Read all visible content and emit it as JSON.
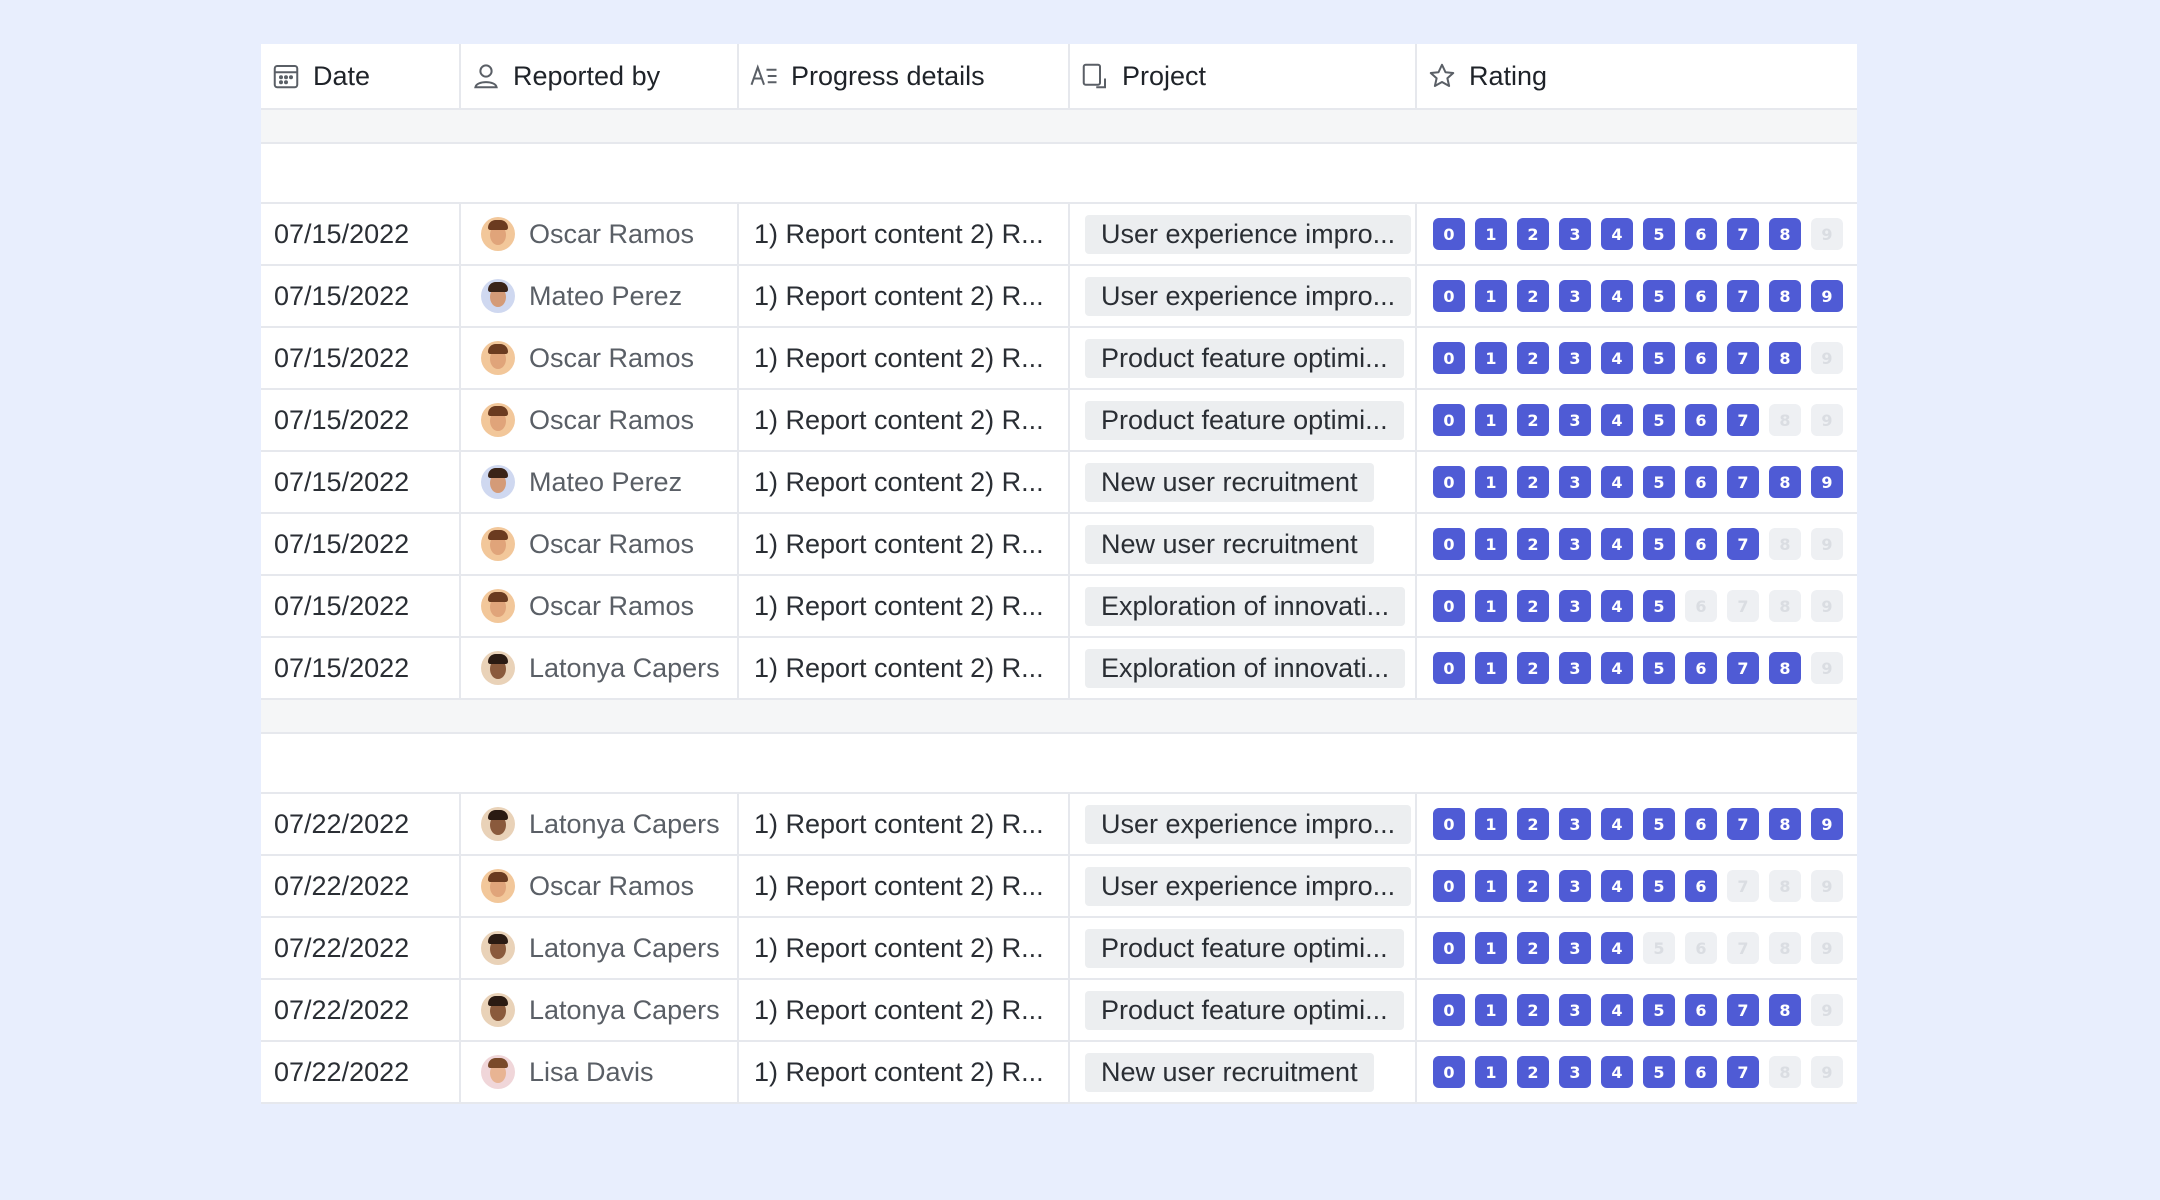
{
  "columns": {
    "date": "Date",
    "reported_by": "Reported by",
    "progress": "Progress details",
    "project": "Project",
    "rating": "Rating"
  },
  "icons": {
    "date": "calendar-icon",
    "reported_by": "person-icon",
    "progress": "text-field-icon",
    "project": "project-icon",
    "rating": "star-icon"
  },
  "colors": {
    "rating_on": "#4f5bd5",
    "rating_off": "#eef0f3",
    "background": "#e8eefd"
  },
  "rating_scale": [
    "0",
    "1",
    "2",
    "3",
    "4",
    "5",
    "6",
    "7",
    "8",
    "9"
  ],
  "groups": [
    {
      "rows": [
        {
          "date": "07/15/2022",
          "reporter": "Oscar Ramos",
          "progress": "1) Report content 2) R...",
          "project": "User experience impro...",
          "rating": 8
        },
        {
          "date": "07/15/2022",
          "reporter": "Mateo Perez",
          "progress": "1) Report content 2) R...",
          "project": "User experience impro...",
          "rating": 9
        },
        {
          "date": "07/15/2022",
          "reporter": "Oscar Ramos",
          "progress": "1) Report content 2) R...",
          "project": "Product feature optimi...",
          "rating": 8
        },
        {
          "date": "07/15/2022",
          "reporter": "Oscar Ramos",
          "progress": "1) Report content 2) R...",
          "project": "Product feature optimi...",
          "rating": 7
        },
        {
          "date": "07/15/2022",
          "reporter": "Mateo Perez",
          "progress": "1) Report content 2) R...",
          "project": "New user recruitment",
          "rating": 9
        },
        {
          "date": "07/15/2022",
          "reporter": "Oscar Ramos",
          "progress": "1) Report content 2) R...",
          "project": "New user recruitment",
          "rating": 7
        },
        {
          "date": "07/15/2022",
          "reporter": "Oscar Ramos",
          "progress": "1) Report content 2) R...",
          "project": "Exploration of innovati...",
          "rating": 5
        },
        {
          "date": "07/15/2022",
          "reporter": "Latonya Capers",
          "progress": "1) Report content 2) R...",
          "project": "Exploration of innovati...",
          "rating": 8
        }
      ]
    },
    {
      "rows": [
        {
          "date": "07/22/2022",
          "reporter": "Latonya Capers",
          "progress": "1) Report content 2) R...",
          "project": "User experience impro...",
          "rating": 9
        },
        {
          "date": "07/22/2022",
          "reporter": "Oscar Ramos",
          "progress": "1) Report content 2) R...",
          "project": "User experience impro...",
          "rating": 6
        },
        {
          "date": "07/22/2022",
          "reporter": "Latonya Capers",
          "progress": "1) Report content 2) R...",
          "project": "Product feature optimi...",
          "rating": 4
        },
        {
          "date": "07/22/2022",
          "reporter": "Latonya Capers",
          "progress": "1) Report content 2) R...",
          "project": "Product feature optimi...",
          "rating": 8
        },
        {
          "date": "07/22/2022",
          "reporter": "Lisa Davis",
          "progress": "1) Report content 2) R...",
          "project": "New user recruitment",
          "rating": 7
        }
      ]
    }
  ]
}
